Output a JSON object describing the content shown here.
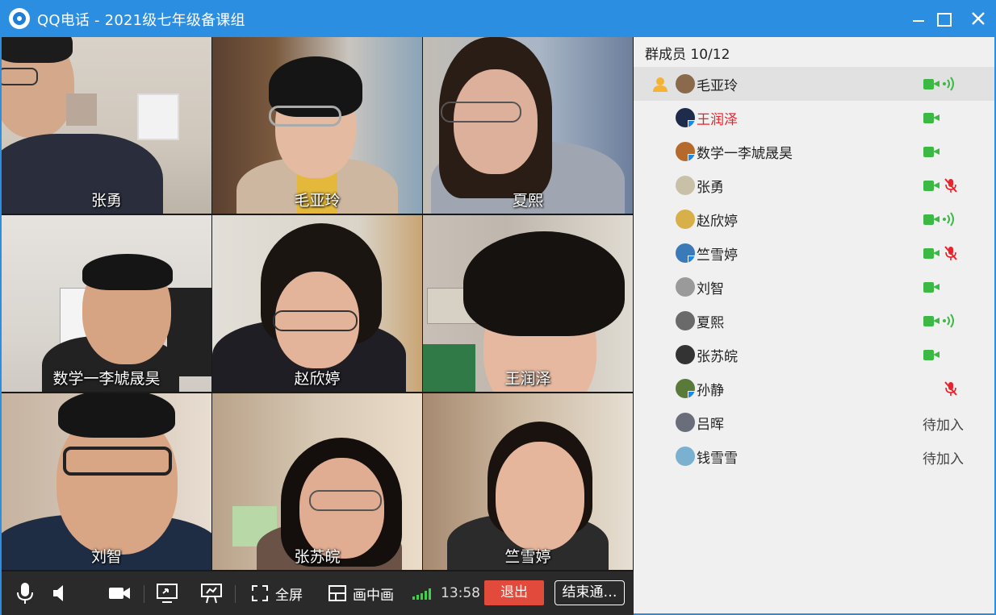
{
  "window": {
    "title": "QQ电话 - 2021级七年级备课组",
    "buttons": [
      "minimize",
      "maximize",
      "close"
    ],
    "accent": "#2b8ee0"
  },
  "video_tiles": [
    {
      "name": "张勇"
    },
    {
      "name": "毛亚玲"
    },
    {
      "name": "夏熙"
    },
    {
      "name": "数学一李虓晟昊"
    },
    {
      "name": "赵欣婷"
    },
    {
      "name": "王润泽"
    },
    {
      "name": "刘智"
    },
    {
      "name": "张苏皖"
    },
    {
      "name": "竺雪婷"
    }
  ],
  "toolbar": {
    "fullscreen_label": "全屏",
    "pip_label": "画中画",
    "time": "13:58",
    "exit_label": "退出",
    "end_label": "结束通…"
  },
  "panel": {
    "title": "群成员 10/12",
    "members": [
      {
        "name": "毛亚玲",
        "host": true,
        "camera": true,
        "status": "speaking",
        "highlight": true
      },
      {
        "name": "王润泽",
        "camera": true,
        "status": "",
        "name_color": "#e8232b"
      },
      {
        "name": "数学一李虓晟昊",
        "camera": true,
        "status": ""
      },
      {
        "name": "张勇",
        "camera": true,
        "status": "muted"
      },
      {
        "name": "赵欣婷",
        "camera": true,
        "status": "speaking"
      },
      {
        "name": "竺雪婷",
        "camera": true,
        "status": "muted"
      },
      {
        "name": "刘智",
        "camera": true,
        "status": ""
      },
      {
        "name": "夏熙",
        "camera": true,
        "status": "speaking"
      },
      {
        "name": "张苏皖",
        "camera": true,
        "status": ""
      },
      {
        "name": "孙静",
        "camera": false,
        "status": "muted"
      },
      {
        "name": "吕晖",
        "camera": false,
        "status": "pending",
        "pending_label": "待加入"
      },
      {
        "name": "钱雪雪",
        "camera": false,
        "status": "pending",
        "pending_label": "待加入"
      }
    ]
  },
  "colors": {
    "camera_on": "#3cb944",
    "mic_muted": "#e8232b",
    "exit_button": "#e24a3b"
  }
}
